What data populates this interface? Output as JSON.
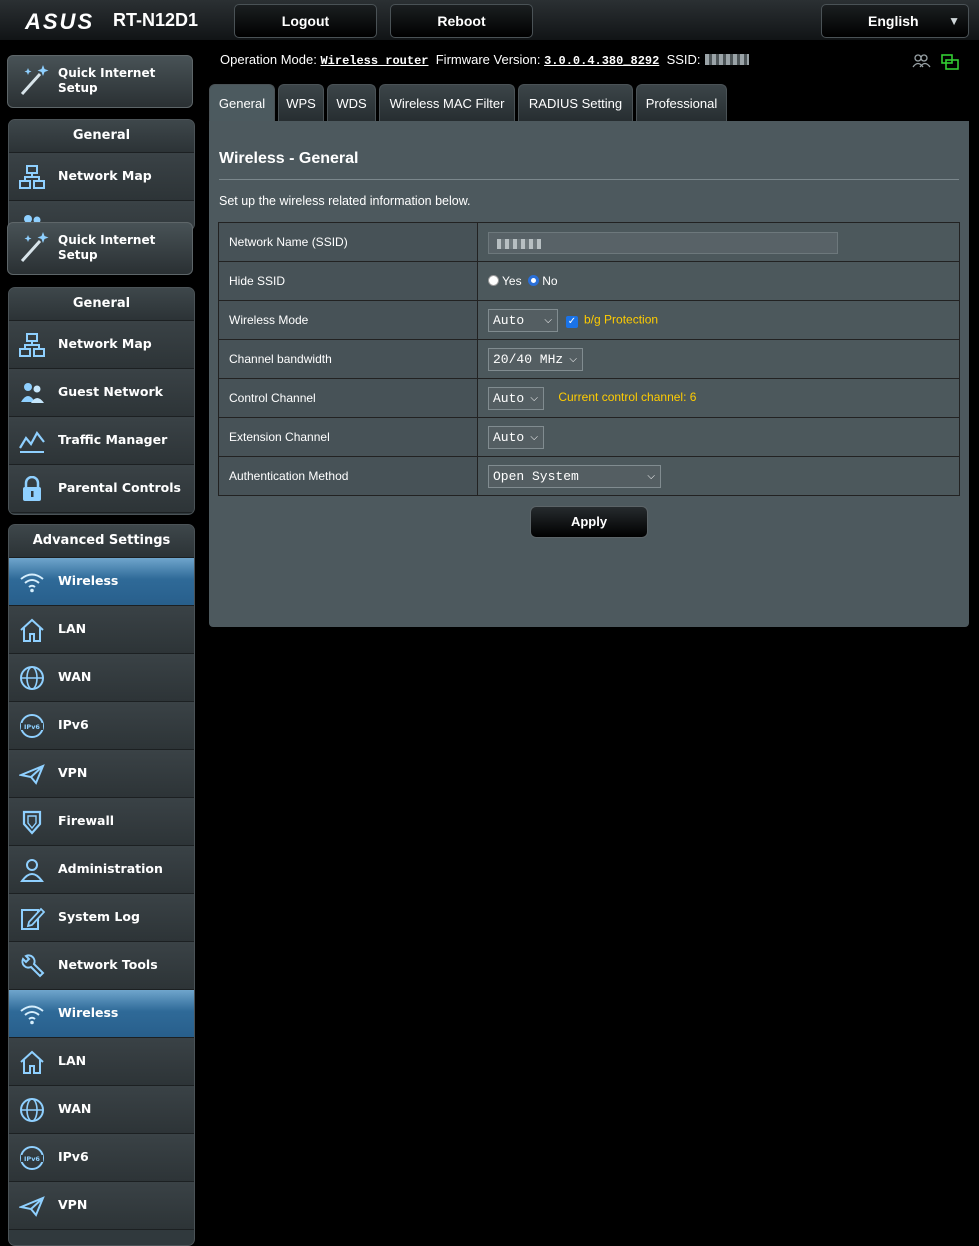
{
  "header": {
    "brand": "ASUS",
    "model": "RT-N12D1",
    "logout_label": "Logout",
    "reboot_label": "Reboot",
    "language": "English"
  },
  "info": {
    "op_mode_label": "Operation Mode:",
    "op_mode_value": "Wireless router",
    "firmware_label": "Firmware Version:",
    "firmware_value": "3.0.0.4.380_8292",
    "ssid_label": "SSID:"
  },
  "sidebar": {
    "quick_setup": "Quick Internet Setup",
    "general_title": "General",
    "general_items": [
      "Network Map",
      "Guest Network",
      "Traffic Manager",
      "Parental Controls"
    ],
    "advanced_title": "Advanced Settings",
    "advanced_items": [
      "Wireless",
      "LAN",
      "WAN",
      "IPv6",
      "VPN",
      "Firewall",
      "Administration",
      "System Log",
      "Network Tools"
    ],
    "repeat_items": [
      "Wireless",
      "LAN",
      "WAN",
      "IPv6",
      "VPN"
    ]
  },
  "tabs": [
    "General",
    "WPS",
    "WDS",
    "Wireless MAC Filter",
    "RADIUS Setting",
    "Professional"
  ],
  "panel": {
    "title": "Wireless - General",
    "description": "Set up the wireless related information below.",
    "rows": {
      "ssid_label": "Network Name (SSID)",
      "hide_ssid_label": "Hide SSID",
      "hide_yes": "Yes",
      "hide_no": "No",
      "mode_label": "Wireless Mode",
      "mode_value": "Auto",
      "bg_protection": "b/g Protection",
      "bandwidth_label": "Channel bandwidth",
      "bandwidth_value": "20/40 MHz",
      "control_label": "Control Channel",
      "control_value": "Auto",
      "current_channel": "Current control channel: 6",
      "extension_label": "Extension Channel",
      "extension_value": "Auto",
      "auth_label": "Authentication Method",
      "auth_value": "Open System"
    },
    "apply_label": "Apply"
  },
  "colors": {
    "accent": "#ffcc00",
    "active_menu": "#2f6a98",
    "panel": "#4d595e"
  }
}
